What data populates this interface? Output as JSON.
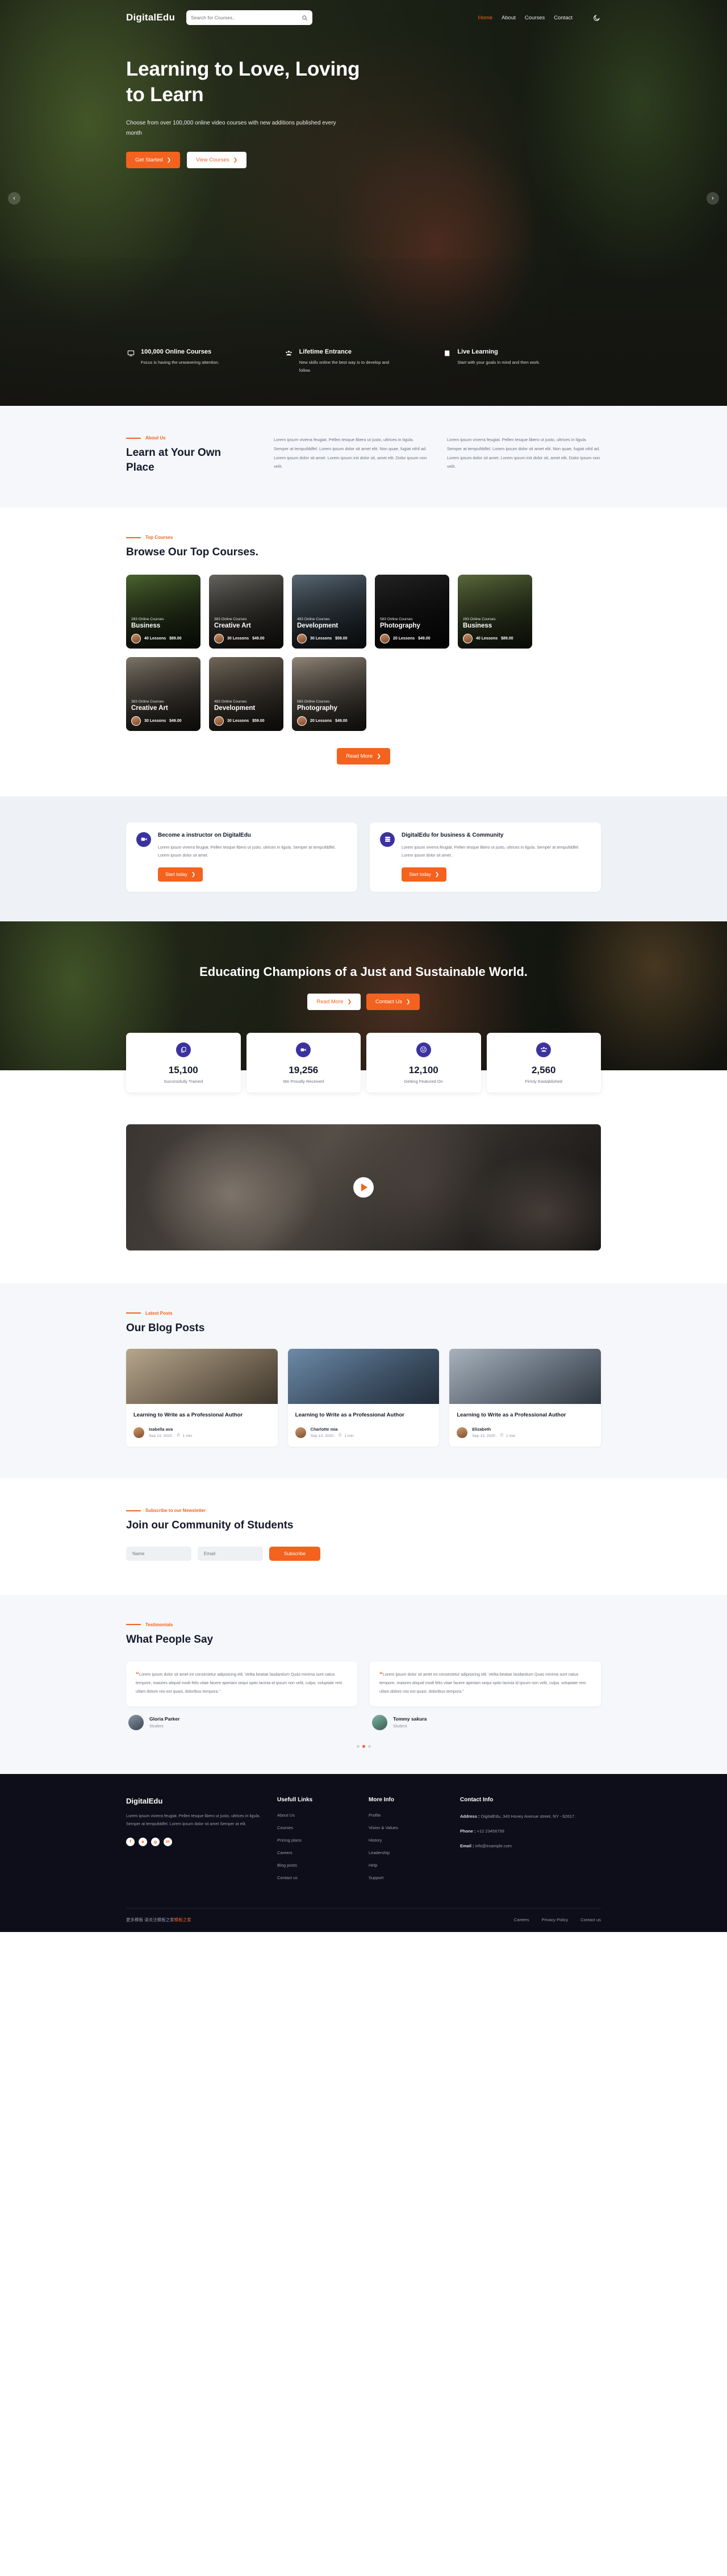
{
  "header": {
    "brand": "DigitalEdu",
    "search_placeholder": "Search for Courses..",
    "nav": [
      {
        "label": "Home",
        "active": true
      },
      {
        "label": "About",
        "active": false
      },
      {
        "label": "Courses",
        "active": false
      },
      {
        "label": "Contact",
        "active": false
      }
    ],
    "mode_icon": "moon-icon"
  },
  "hero": {
    "title": "Learning to Love, Loving to Learn",
    "subtitle": "Choose from over 100,000 online video courses with new additions published every month",
    "primary_btn": "Get Started",
    "secondary_btn": "View Courses",
    "prev_icon": "chevron-left-icon",
    "next_icon": "chevron-right-icon",
    "features": [
      {
        "icon": "monitor-icon",
        "title": "100,000 Online Courses",
        "desc": "Focus is having the unwavering attention."
      },
      {
        "icon": "group-icon",
        "title": "Lifetime Entrance",
        "desc": "New skills online the best way is to develop and follow."
      },
      {
        "icon": "book-icon",
        "title": "Live Learning",
        "desc": "Start with your goals in mind and then work."
      }
    ]
  },
  "about": {
    "eyebrow": "About Us",
    "title": "Learn at Your Own Place",
    "col1": "Lorem ipsum viverra feugiat. Pellen tesque libero ut justo, ultrices in ligula. Semper at tempufddfel. Lorem ipsum dolor sit amet elit. Non quae, fugiat nihil ad. Lorem ipsum dolor sit amet. Lorem ipsum init dolor sit, amet elit. Dolor ipsum non velit.",
    "col2": "Lorem ipsum viverra feugiat. Pellen tesque libero ut justo, ultrices in ligula. Semper at tempufddfel. Lorem ipsum dolor sit amet elit. Non quae, fugiat nihil ad. Lorem ipsum dolor sit amet. Lorem ipsum init dolor sit, amet elit. Dolor ipsum non velit."
  },
  "courses": {
    "eyebrow": "Top Courses",
    "title": "Browse Our Top Courses.",
    "read_more": "Read More",
    "items": [
      {
        "count": "283 Online Courses",
        "name": "Business",
        "lessons": "40 Lessons",
        "price": "$89.00",
        "ph": "p1"
      },
      {
        "count": "383 Online Courses",
        "name": "Creative Art",
        "lessons": "30 Lessons",
        "price": "$49.00",
        "ph": "p2"
      },
      {
        "count": "483 Online Courses",
        "name": "Development",
        "lessons": "30 Lessons",
        "price": "$59.00",
        "ph": "p3"
      },
      {
        "count": "583 Online Courses",
        "name": "Photography",
        "lessons": "20 Lessons",
        "price": "$49.00",
        "ph": "p4"
      },
      {
        "count": "283 Online Courses",
        "name": "Business",
        "lessons": "40 Lessons",
        "price": "$89.00",
        "ph": "p5"
      },
      {
        "count": "383 Online Courses",
        "name": "Creative Art",
        "lessons": "30 Lessons",
        "price": "$49.00",
        "ph": "p6"
      },
      {
        "count": "483 Online Courses",
        "name": "Development",
        "lessons": "30 Lessons",
        "price": "$59.00",
        "ph": "p7"
      },
      {
        "count": "583 Online Courses",
        "name": "Photography",
        "lessons": "20 Lessons",
        "price": "$49.00",
        "ph": "p8"
      }
    ]
  },
  "cta": [
    {
      "icon": "video-camera-icon",
      "title": "Become a instructor on DigitalEdu",
      "desc": "Lorem ipsum viverra feugiat. Pellen tesque libero ut justo, ultrices in ligula. Semper at tempufddfel. Lorem ipsum dolor sit amet.",
      "btn": "Start today"
    },
    {
      "icon": "server-icon",
      "title": "DigitalEdu for business & Community",
      "desc": "Lorem ipsum viverra feugiat. Pellen tesque libero ut justo, ultrices in ligula. Semper at tempufddfel. Lorem ipsum dolor sit amet..",
      "btn": "Start today"
    }
  ],
  "champions": {
    "title": "Educating Champions of a Just and Sustainable World.",
    "btn_light": "Read More",
    "btn_orange": "Contact Us"
  },
  "stats": [
    {
      "icon": "copy-icon",
      "num": "15,100",
      "label": "Successfully Trained"
    },
    {
      "icon": "video-camera-icon",
      "num": "19,256",
      "label": "We Proudly Received"
    },
    {
      "icon": "smile-icon",
      "num": "12,100",
      "label": "Getting Featured On"
    },
    {
      "icon": "group-icon",
      "num": "2,560",
      "label": "Firmly Eastablished"
    }
  ],
  "video": {
    "play_icon": "play-icon"
  },
  "blog": {
    "eyebrow": "Latest Posts",
    "title": "Our Blog Posts",
    "posts": [
      {
        "title": "Learning to Write as a Professional Author",
        "author": "Isabella ava",
        "date": "Sep 13, 2020 .",
        "read": "1 min",
        "ph": "b1"
      },
      {
        "title": "Learning to Write as a Professional Author",
        "author": "Charlotte mia",
        "date": "Sep 13, 2020 .",
        "read": "1 min",
        "ph": "b2"
      },
      {
        "title": "Learning to Write as a Professional Author",
        "author": "Elizabeth",
        "date": "Sep 13, 2020 .",
        "read": "1 min",
        "ph": "b3"
      }
    ]
  },
  "newsletter": {
    "eyebrow": "Subscribe to our Newsletter",
    "title": "Join our Community of Students",
    "name_placeholder": "Name",
    "email_placeholder": "Email",
    "submit": "Subscribe"
  },
  "testimonials": {
    "eyebrow": "Testimonials",
    "title": "What People Say",
    "items": [
      {
        "quote": "Lorem ipsum dolor sit amet int consectetur adipisicing elit. Velita beatae laudantium Quas minima sunt natus tempore, maiores aliquid modi felis vitae facere aperiam sequi optio lacinia id ipsum non velit, culpa. voluptate rem ullam dolore nisi est quasi, doloribus tempora.\"",
        "name": "Gloria Parker",
        "role": "Student"
      },
      {
        "quote": "Lorem ipsum dolor sit amet int consectetur adipisicing elit. Velita beatae laudantium Quas minima sunt natus tempore, maiores aliquid modi felis vitae facere aperiam sequi optio lacinia id ipsum non velit, culpa. voluptate rem ullam dolore nisi est quasi, doloribus tempora.\"",
        "name": "Tommy sakura",
        "role": "Student"
      }
    ]
  },
  "footer": {
    "brand": "DigitalEdu",
    "about": "Lorem ipsum viverra feugiat. Pellen tesque libero ut justo, ultrices in ligula. Semper at tempufddfel. Lorem ipsum dolor sit amet Semper at elit.",
    "socials": [
      {
        "icon": "facebook-icon",
        "glyph": "f"
      },
      {
        "icon": "twitter-icon",
        "glyph": "✈"
      },
      {
        "icon": "instagram-icon",
        "glyph": "◎"
      },
      {
        "icon": "linkedin-icon",
        "glyph": "in"
      }
    ],
    "useful_title": "Usefull Links",
    "useful": [
      "About Us",
      "Courses",
      "Pricing plans",
      "Careers",
      "Blog posts",
      "Contact us"
    ],
    "more_title": "More Info",
    "more": [
      "Profile",
      "Vision & Values",
      "History",
      "Leadership",
      "Help",
      "Support"
    ],
    "contact_title": "Contact Info",
    "address_label": "Address :",
    "address_value": "DigitalEdu, 343 Honey Avenue street, NY - 62617.",
    "phone_label": "Phone :",
    "phone_value": "+12 23456799",
    "email_label": "Email :",
    "email_value": "info@example.com",
    "copyright_cn": "更多模板 请关注模板之家",
    "copyright_link": "模板之家",
    "bottom_links": [
      "Careers",
      "Privacy Policy",
      "Contact us"
    ]
  },
  "colors": {
    "accent": "#f4621f",
    "purple": "#3b32a0",
    "dark": "#0e0e1a",
    "light_bg": "#f5f7fa"
  }
}
